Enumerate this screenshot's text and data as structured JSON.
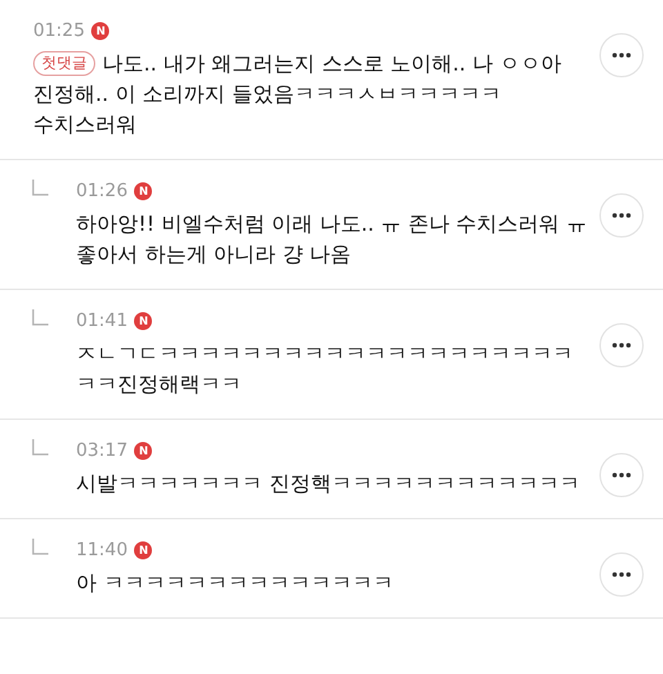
{
  "comments": [
    {
      "kind": "comment",
      "time": "01:25",
      "new_badge": "N",
      "label": "첫댓글",
      "text": "나도.. 내가 왜그러는지 스스로 노이해.. 나 ㅇㅇ아 진정해.. 이 소리까지 들었음ㅋㅋㅋㅅㅂㅋㅋㅋㅋㅋ 수치스러워"
    },
    {
      "kind": "reply",
      "time": "01:26",
      "new_badge": "N",
      "text": "하아앙!! 비엘수처럼 이래 나도.. ㅠ 존나 수치스러워 ㅠ 좋아서 하는게 아니라 걍 나옴"
    },
    {
      "kind": "reply",
      "time": "01:41",
      "new_badge": "N",
      "text": "ㅈㄴㄱㄷㅋㅋㅋㅋㅋㅋㅋㅋㅋㅋㅋㅋㅋㅋㅋㅋㅋㅋㅋㅋㅋㅋ진정해랙ㅋㅋ"
    },
    {
      "kind": "reply",
      "time": "03:17",
      "new_badge": "N",
      "text": "시발ㅋㅋㅋㅋㅋㅋㅋ 진정핵ㅋㅋㅋㅋㅋㅋㅋㅋㅋㅋㅋㅋ"
    },
    {
      "kind": "reply",
      "time": "11:40",
      "new_badge": "N",
      "text": "아 ㅋㅋㅋㅋㅋㅋㅋㅋㅋㅋㅋㅋㅋㅋ"
    }
  ]
}
